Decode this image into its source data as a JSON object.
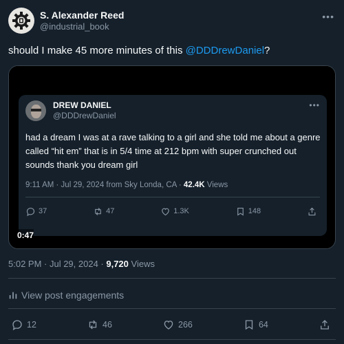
{
  "author": {
    "display_name": "S. Alexander Reed",
    "handle": "@industrial_book"
  },
  "tweet": {
    "text_before": "should I make 45 more minutes of this ",
    "mention": "@DDDrewDaniel",
    "text_after": "?"
  },
  "embed": {
    "display_name": "DREW DANIEL",
    "handle": "@DDDrewDaniel",
    "text": "had a dream I was at a rave talking to a girl and she told me about a genre called “hit em” that is in 5/4 time at 212 bpm with super crunched out sounds thank you dream girl",
    "meta_prefix": "9:11 AM · Jul 29, 2024 from Sky Londa, CA · ",
    "views_count": "42.4K",
    "views_label": " Views",
    "replies": "37",
    "reposts": "47",
    "likes": "1.3K",
    "bookmarks": "148",
    "video_time": "0:47"
  },
  "meta": {
    "prefix": "5:02 PM · Jul 29, 2024 · ",
    "views_count": "9,720",
    "views_label": " Views"
  },
  "engagements_label": "View post engagements",
  "actions": {
    "replies": "12",
    "reposts": "46",
    "likes": "266",
    "bookmarks": "64"
  },
  "icons": {
    "more": "more-icon",
    "reply": "reply-icon",
    "repost": "repost-icon",
    "like": "heart-icon",
    "bookmark": "bookmark-icon",
    "share": "share-icon",
    "analytics": "analytics-icon"
  },
  "colors": {
    "background": "#15202b",
    "accent": "#1d9bf0",
    "secondary_text": "#8b98a5",
    "border": "#38444d"
  }
}
